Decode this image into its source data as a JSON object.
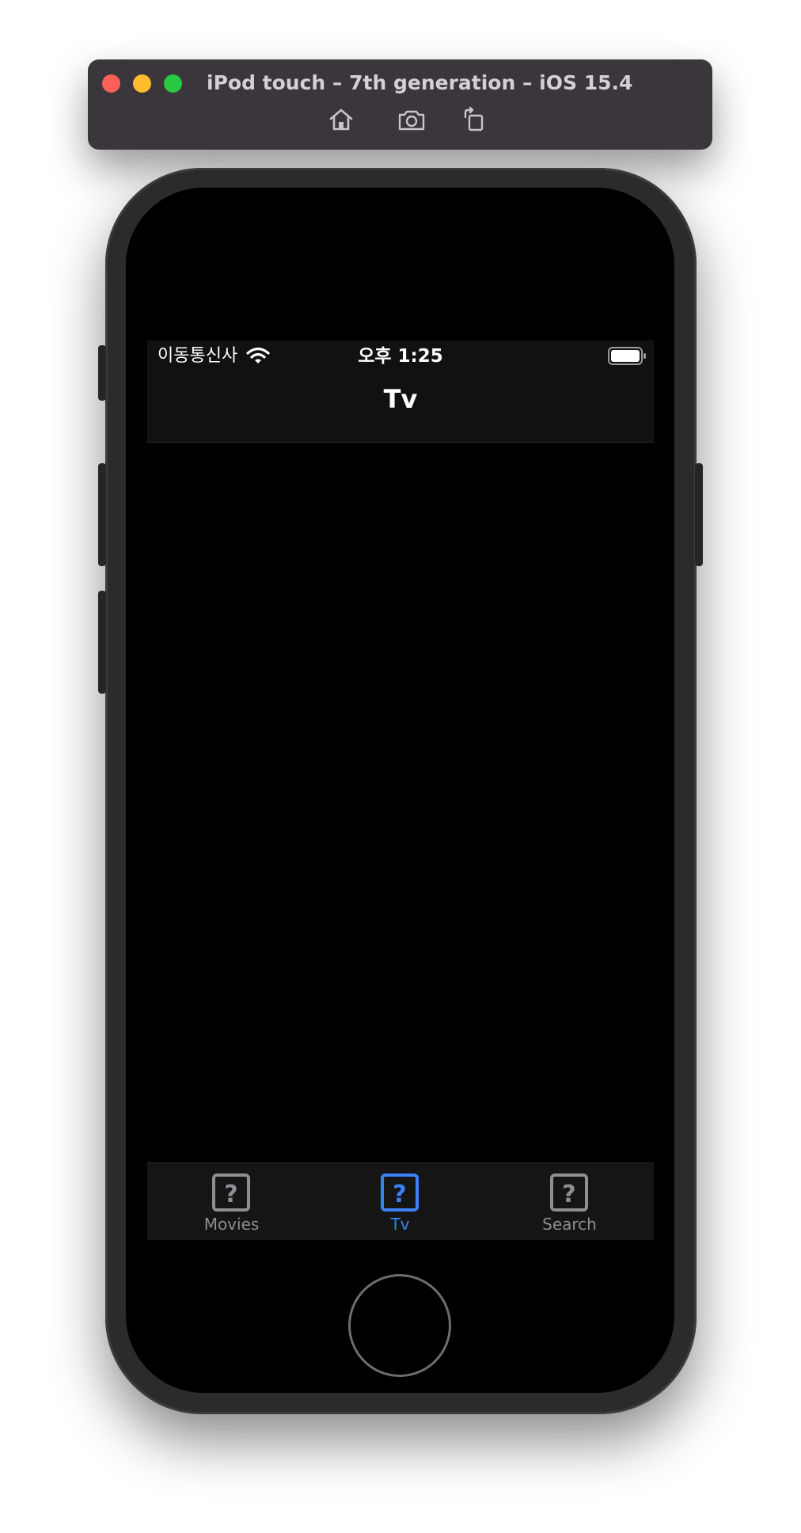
{
  "simulator": {
    "title": "iPod touch – 7th generation – iOS 15.4",
    "toolbar": [
      {
        "icon": "home-icon"
      },
      {
        "icon": "screenshot-icon"
      },
      {
        "icon": "rotate-icon"
      }
    ]
  },
  "status_bar": {
    "carrier": "이동통신사",
    "time": "오후 1:25",
    "wifi_icon": "wifi-icon",
    "battery_icon": "battery-icon"
  },
  "nav": {
    "title": "Tv"
  },
  "tabs": [
    {
      "label": "Movies",
      "icon": "question-square-icon",
      "active": false
    },
    {
      "label": "Tv",
      "icon": "question-square-icon",
      "active": true
    },
    {
      "label": "Search",
      "icon": "question-square-icon",
      "active": false
    }
  ],
  "colors": {
    "accent": "#3a82f7",
    "inactive": "#8e8e93",
    "bar_background": "#151515",
    "screen_background": "#000000"
  }
}
